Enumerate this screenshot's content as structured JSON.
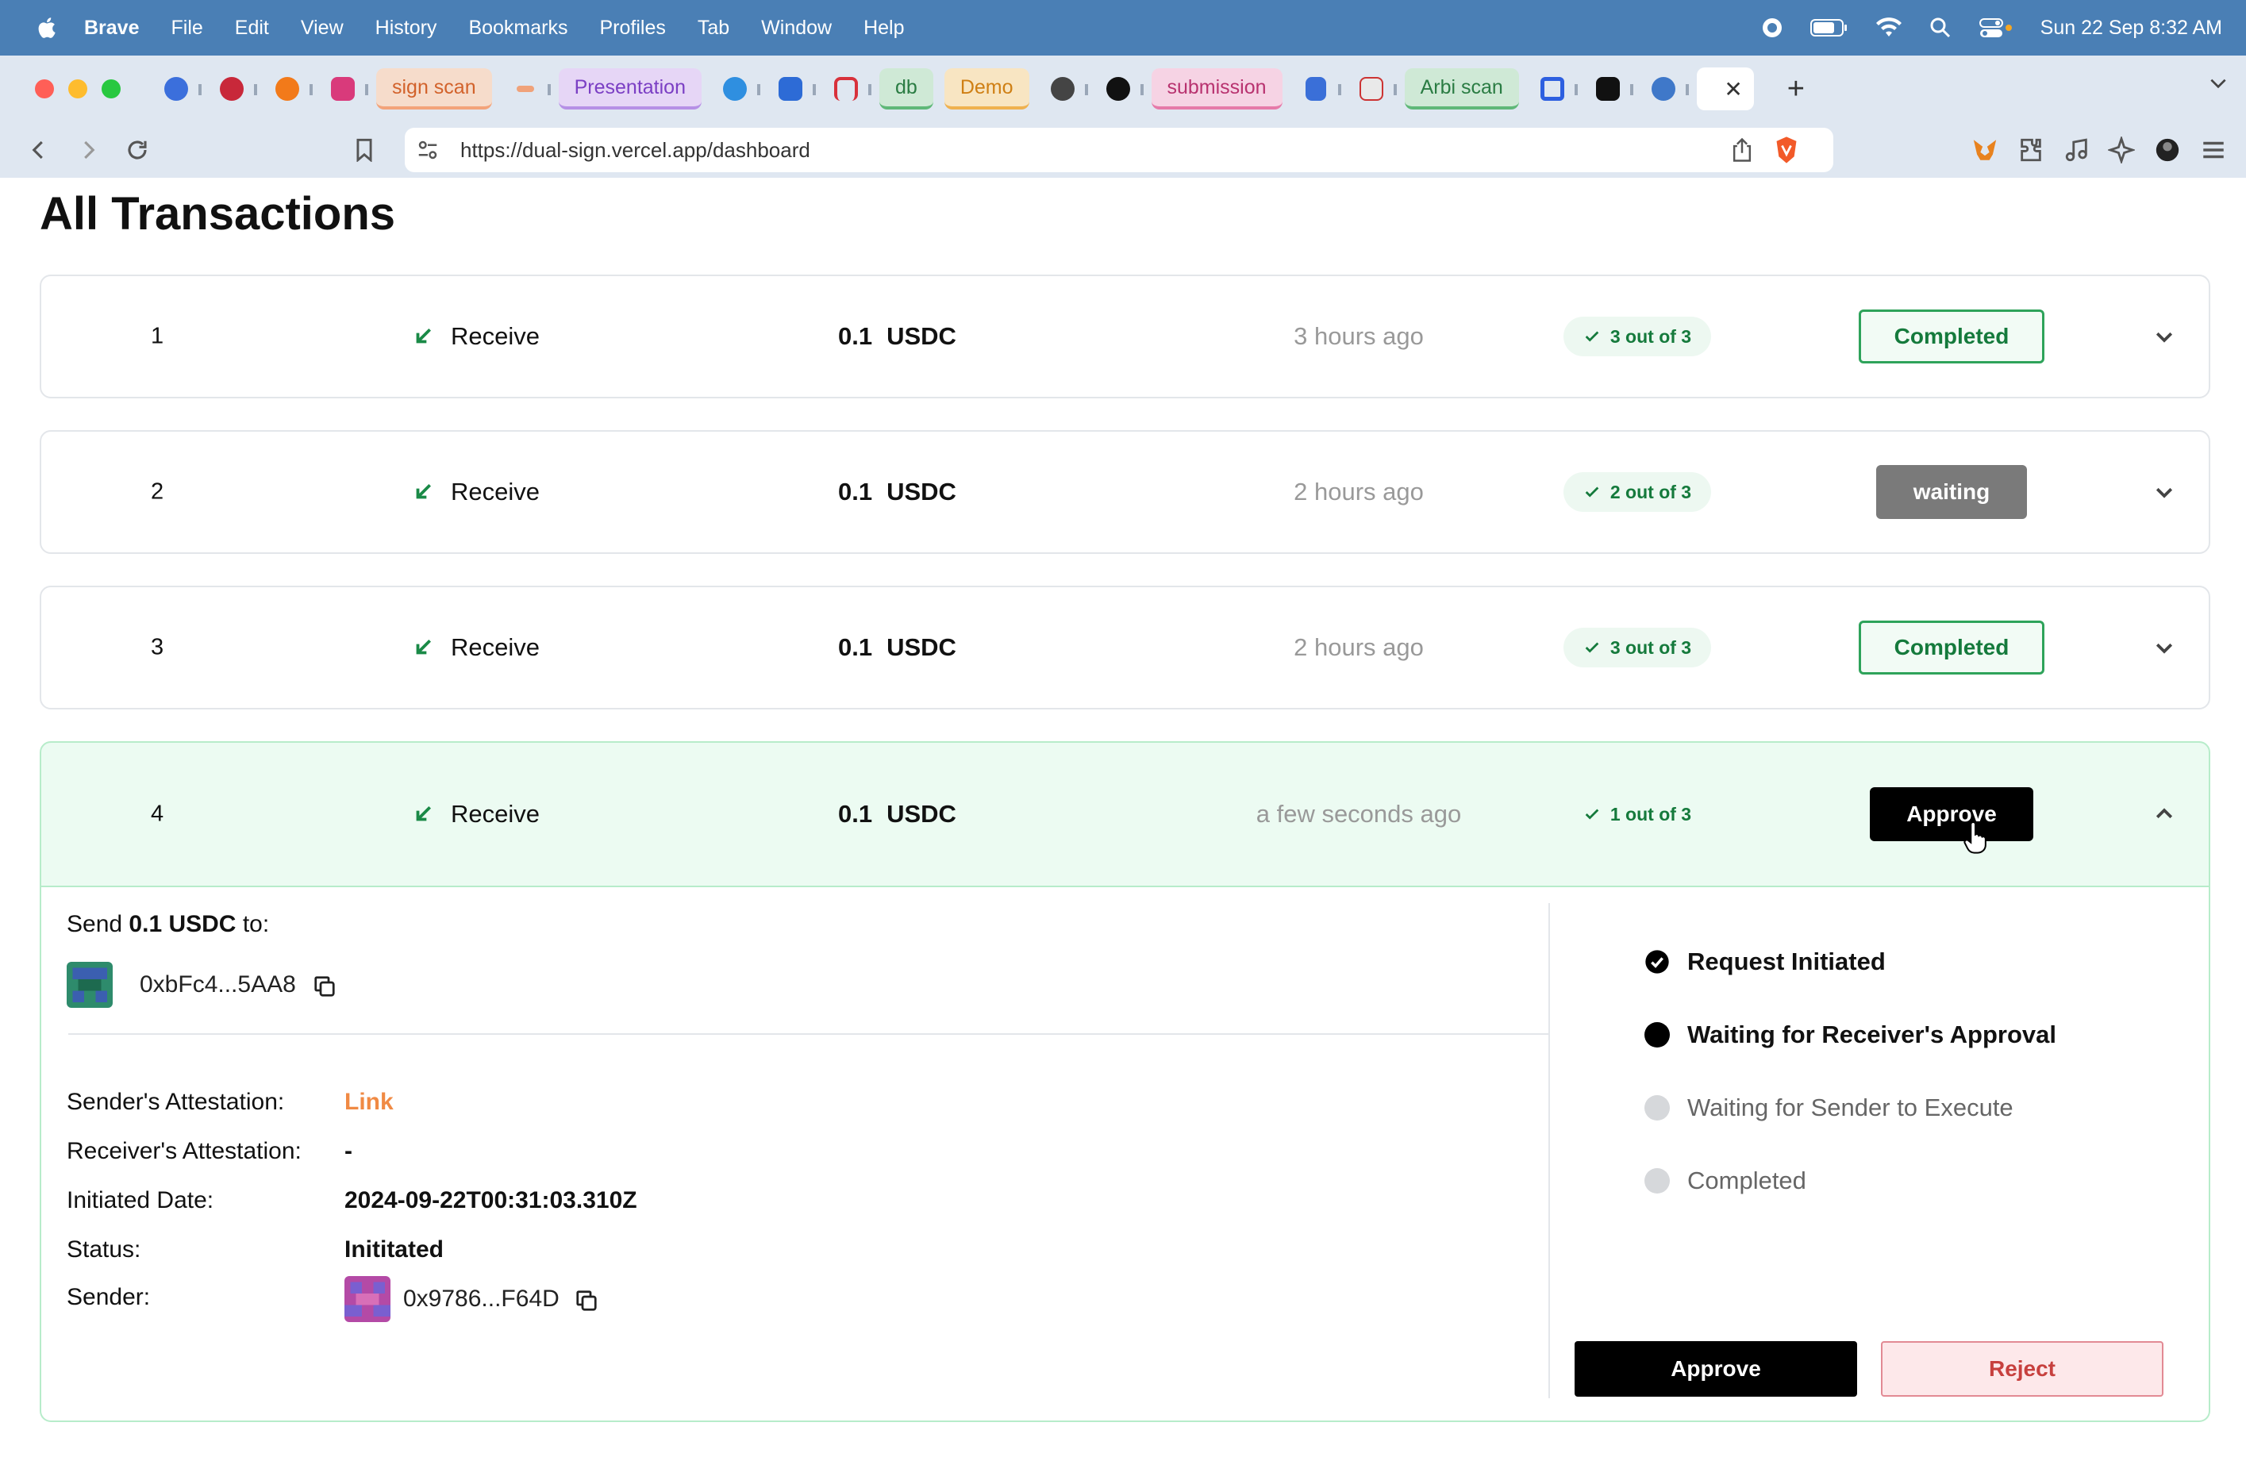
{
  "menubar": {
    "app": "Brave",
    "items": [
      "File",
      "Edit",
      "View",
      "History",
      "Bookmarks",
      "Profiles",
      "Tab",
      "Window",
      "Help"
    ],
    "clock": "Sun 22 Sep  8:32 AM"
  },
  "tabs": {
    "groups": [
      {
        "label": "sign scan",
        "bg": "#f6dccb",
        "fg": "#d2622b",
        "underline": "#f3a37a"
      },
      {
        "label": "Presentation",
        "bg": "#e6d6f6",
        "fg": "#7b3fc4",
        "underline": "#b690e6"
      },
      {
        "label": "db",
        "bg": "#cfe9d6",
        "fg": "#2a7c43",
        "underline": "#5fb878"
      },
      {
        "label": "Demo",
        "bg": "#f8e5c2",
        "fg": "#cf7f14",
        "underline": "#efb14f"
      },
      {
        "label": "submission",
        "bg": "#f6d3e4",
        "fg": "#b8326f",
        "underline": "#e67aa9"
      },
      {
        "label": "Arbi scan",
        "bg": "#cfe9d6",
        "fg": "#2a7c43",
        "underline": "#5fb878"
      }
    ],
    "active_close": "✕",
    "new_tab": "+"
  },
  "address": {
    "url": "https://dual-sign.vercel.app/dashboard"
  },
  "page": {
    "title": "All Transactions"
  },
  "transactions": [
    {
      "id": "1",
      "type": "Receive",
      "amount": "0.1",
      "currency": "USDC",
      "time": "3 hours ago",
      "sigs": "3 out of 3",
      "status": "Completed"
    },
    {
      "id": "2",
      "type": "Receive",
      "amount": "0.1",
      "currency": "USDC",
      "time": "2 hours ago",
      "sigs": "2 out of 3",
      "status": "waiting"
    },
    {
      "id": "3",
      "type": "Receive",
      "amount": "0.1",
      "currency": "USDC",
      "time": "2 hours ago",
      "sigs": "3 out of 3",
      "status": "Completed"
    },
    {
      "id": "4",
      "type": "Receive",
      "amount": "0.1",
      "currency": "USDC",
      "time": "a few seconds ago",
      "sigs": "1 out of 3",
      "status": "Approve"
    }
  ],
  "detail": {
    "send_prefix": "Send",
    "send_amount": "0.1 USDC",
    "send_suffix": "to:",
    "recipient": "0xbFc4...5AA8",
    "fields": {
      "sender_att_label": "Sender's Attestation:",
      "sender_att_value": "Link",
      "receiver_att_label": "Receiver's Attestation:",
      "receiver_att_value": "-",
      "date_label": "Initiated Date:",
      "date_value": "2024-09-22T00:31:03.310Z",
      "status_label": "Status:",
      "status_value": "Inititated",
      "sender_label": "Sender:",
      "sender_value": "0x9786...F64D"
    },
    "steps": [
      {
        "label": "Request Initiated",
        "state": "done"
      },
      {
        "label": "Waiting for Receiver's Approval",
        "state": "current"
      },
      {
        "label": "Waiting for Sender to Execute",
        "state": "pending"
      },
      {
        "label": "Completed",
        "state": "pending"
      }
    ],
    "approve_label": "Approve",
    "reject_label": "Reject"
  },
  "colors": {
    "menubar": "#4a7fb5",
    "tabstrip": "#dfe7f1",
    "success": "#157a3c",
    "link": "#f08a44",
    "expanded_row": "#ecfbf2"
  }
}
